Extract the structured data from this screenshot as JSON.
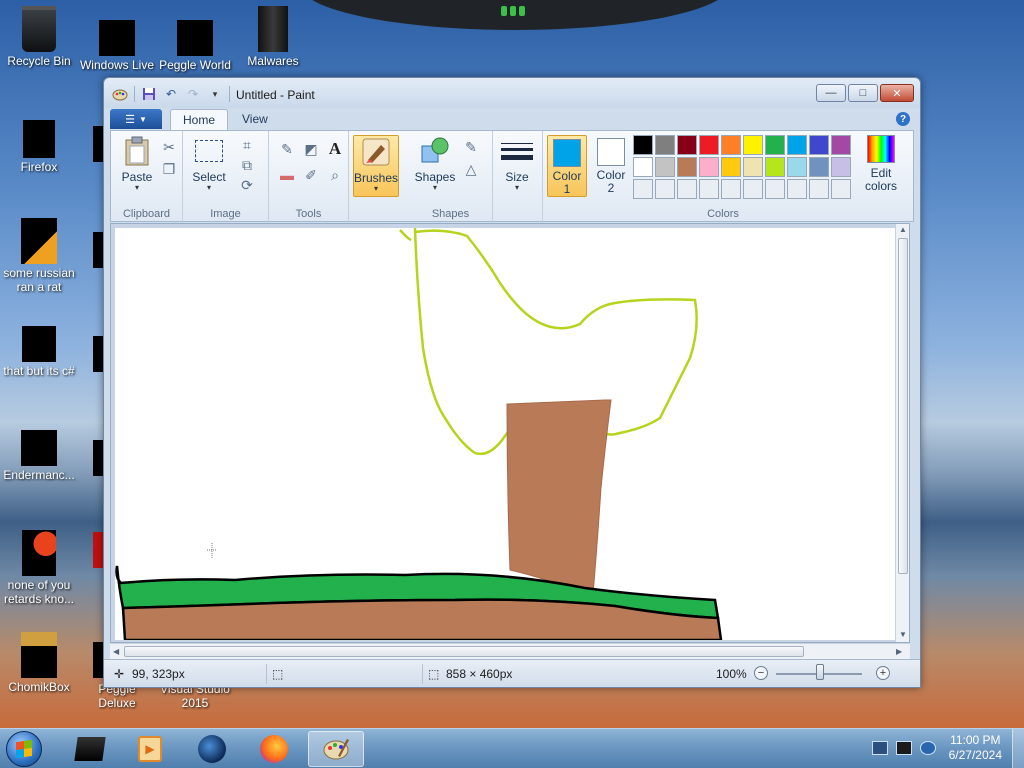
{
  "desktop": {
    "icons": [
      {
        "label": "Recycle Bin"
      },
      {
        "label": "Windows Live"
      },
      {
        "label": "Peggle World"
      },
      {
        "label": "Malwares"
      },
      {
        "label": "Firefox"
      },
      {
        "label": "some russian ran a rat"
      },
      {
        "label": "that but its c#"
      },
      {
        "label": "Endermanc..."
      },
      {
        "label": "none of you retards kno..."
      },
      {
        "label": "ChomikBox"
      },
      {
        "label": "Peggle Deluxe"
      },
      {
        "label": "Visual Studio 2015"
      }
    ]
  },
  "paint": {
    "title": "Untitled - Paint",
    "tabs": {
      "home": "Home",
      "view": "View"
    },
    "groups": {
      "clipboard": "Clipboard",
      "image": "Image",
      "tools": "Tools",
      "shapes": "Shapes",
      "colors": "Colors"
    },
    "buttons": {
      "paste": "Paste",
      "select": "Select",
      "brushes": "Brushes",
      "shapes": "Shapes",
      "size": "Size",
      "color1": "Color",
      "color1_num": "1",
      "color2": "Color",
      "color2_num": "2",
      "edit_colors": "Edit colors"
    },
    "color1_value": "#00a2e8",
    "color2_value": "#ffffff",
    "palette_row1": [
      "#000000",
      "#7f7f7f",
      "#880015",
      "#ed1c24",
      "#ff7f27",
      "#fff200",
      "#22b14c",
      "#00a2e8",
      "#3f48cc",
      "#a349a4"
    ],
    "palette_row2": [
      "#ffffff",
      "#c3c3c3",
      "#b97a57",
      "#ffaec9",
      "#ffc90e",
      "#efe4b0",
      "#b5e61d",
      "#99d9ea",
      "#7092be",
      "#c8bfe7"
    ],
    "status": {
      "cursor_pos": "99, 323px",
      "canvas_size": "858 × 460px",
      "zoom": "100%"
    }
  },
  "taskbar": {
    "time": "11:00 PM",
    "date": "6/27/2024"
  }
}
